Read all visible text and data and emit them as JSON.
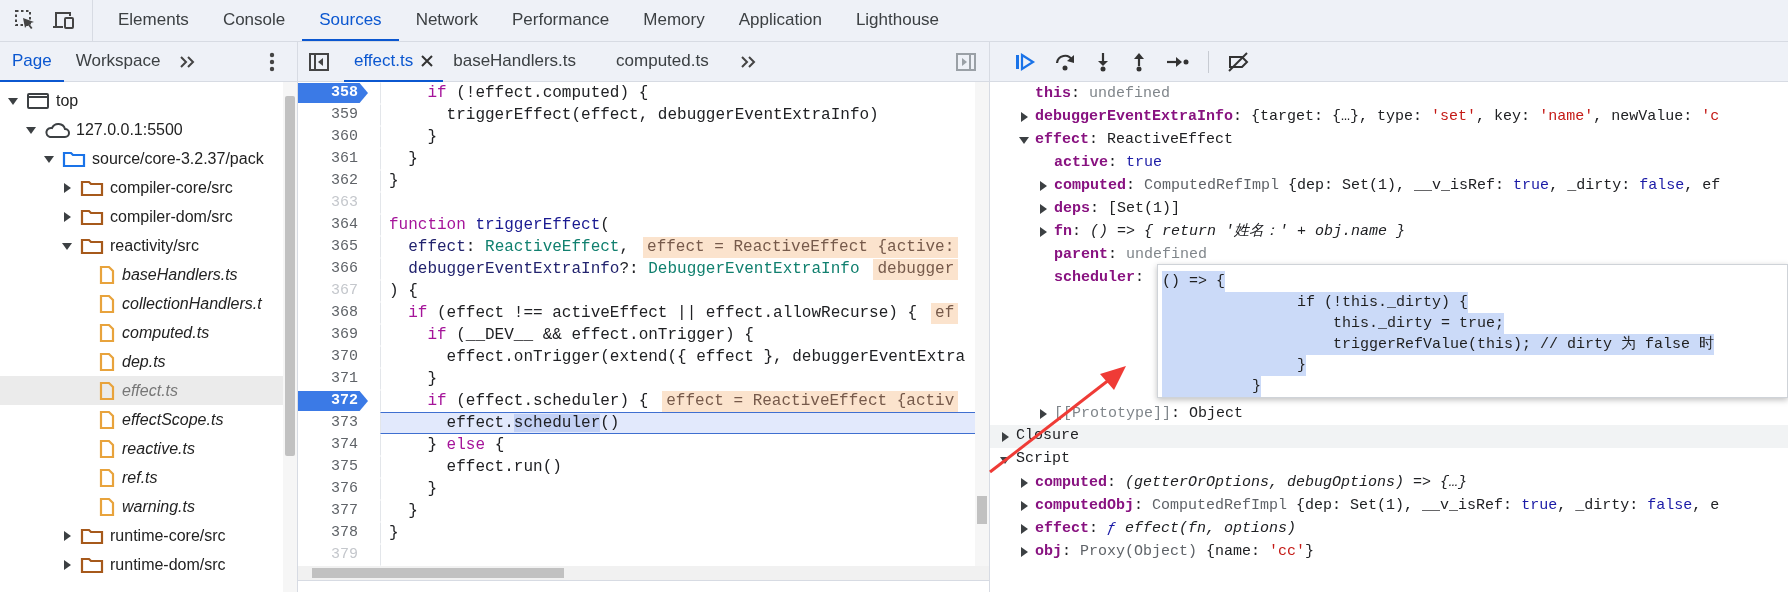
{
  "main_tabs": [
    {
      "label": "Elements",
      "selected": false
    },
    {
      "label": "Console",
      "selected": false
    },
    {
      "label": "Sources",
      "selected": true
    },
    {
      "label": "Network",
      "selected": false
    },
    {
      "label": "Performance",
      "selected": false
    },
    {
      "label": "Memory",
      "selected": false
    },
    {
      "label": "Application",
      "selected": false
    },
    {
      "label": "Lighthouse",
      "selected": false
    }
  ],
  "navigator": {
    "tabs": [
      {
        "label": "Page",
        "selected": true
      },
      {
        "label": "Workspace",
        "selected": false
      }
    ],
    "tree": [
      {
        "label": "top",
        "kind": "frame",
        "expanded": true,
        "selected": false,
        "children": [
          {
            "label": "127.0.0.1:5500",
            "kind": "origin",
            "expanded": true,
            "selected": false,
            "children": [
              {
                "label": "source/core-3.2.37/pack",
                "kind": "root-folder",
                "expanded": true,
                "selected": false,
                "children": [
                  {
                    "label": "compiler-core/src",
                    "kind": "folder",
                    "expanded": false,
                    "selected": false
                  },
                  {
                    "label": "compiler-dom/src",
                    "kind": "folder",
                    "expanded": false,
                    "selected": false
                  },
                  {
                    "label": "reactivity/src",
                    "kind": "folder",
                    "expanded": true,
                    "selected": false,
                    "children": [
                      {
                        "label": "baseHandlers.ts",
                        "kind": "file",
                        "selected": false
                      },
                      {
                        "label": "collectionHandlers.t",
                        "kind": "file",
                        "selected": false
                      },
                      {
                        "label": "computed.ts",
                        "kind": "file",
                        "selected": false
                      },
                      {
                        "label": "dep.ts",
                        "kind": "file",
                        "selected": false
                      },
                      {
                        "label": "effect.ts",
                        "kind": "file",
                        "selected": true
                      },
                      {
                        "label": "effectScope.ts",
                        "kind": "file",
                        "selected": false
                      },
                      {
                        "label": "reactive.ts",
                        "kind": "file",
                        "selected": false
                      },
                      {
                        "label": "ref.ts",
                        "kind": "file",
                        "selected": false
                      },
                      {
                        "label": "warning.ts",
                        "kind": "file",
                        "selected": false
                      }
                    ]
                  },
                  {
                    "label": "runtime-core/src",
                    "kind": "folder",
                    "expanded": false,
                    "selected": false
                  },
                  {
                    "label": "runtime-dom/src",
                    "kind": "folder",
                    "expanded": false,
                    "selected": false
                  }
                ]
              }
            ]
          }
        ]
      }
    ]
  },
  "editor": {
    "tabs": [
      {
        "label": "effect.ts",
        "selected": true,
        "closable": true
      },
      {
        "label": "baseHandlers.ts",
        "selected": false,
        "closable": false
      },
      {
        "label": "computed.ts",
        "selected": false,
        "closable": false
      }
    ],
    "lines": [
      {
        "number": "358",
        "breakpoint": true,
        "breakable": true,
        "current": false,
        "tokens": [
          {
            "text": "    if",
            "kind": "kw"
          },
          {
            "text": " (!effect.computed) {",
            "kind": "plain"
          }
        ]
      },
      {
        "number": "359",
        "breakpoint": false,
        "breakable": true,
        "current": false,
        "tokens": [
          {
            "text": "      triggerEffect(effect, debuggerEventExtraInfo)",
            "kind": "plain"
          }
        ]
      },
      {
        "number": "360",
        "breakpoint": false,
        "breakable": true,
        "current": false,
        "tokens": [
          {
            "text": "    }",
            "kind": "plain"
          }
        ]
      },
      {
        "number": "361",
        "breakpoint": false,
        "breakable": true,
        "current": false,
        "tokens": [
          {
            "text": "  }",
            "kind": "plain"
          }
        ]
      },
      {
        "number": "362",
        "breakpoint": false,
        "breakable": true,
        "current": false,
        "tokens": [
          {
            "text": "}",
            "kind": "plain"
          }
        ]
      },
      {
        "number": "363",
        "breakpoint": false,
        "breakable": false,
        "current": false
      },
      {
        "number": "364",
        "breakpoint": false,
        "breakable": true,
        "current": false,
        "tokens": [
          {
            "text": "function",
            "kind": "kw"
          },
          {
            "text": " triggerEffect",
            "kind": "def"
          },
          {
            "text": "(",
            "kind": "plain"
          }
        ]
      },
      {
        "number": "365",
        "breakpoint": false,
        "breakable": true,
        "current": false,
        "tokens": [
          {
            "text": "  effect",
            "kind": "param"
          },
          {
            "text": ":",
            "kind": "plain"
          },
          {
            "text": " ReactiveEffect",
            "kind": "type"
          },
          {
            "text": ",",
            "kind": "plain"
          }
        ],
        "hint": "effect = ReactiveEffect {active:"
      },
      {
        "number": "366",
        "breakpoint": false,
        "breakable": true,
        "current": false,
        "tokens": [
          {
            "text": "  debuggerEventExtraInfo",
            "kind": "param"
          },
          {
            "text": "?:",
            "kind": "plain"
          },
          {
            "text": " DebuggerEventExtraInfo",
            "kind": "type"
          }
        ],
        "hint": "debugger"
      },
      {
        "number": "367",
        "breakpoint": false,
        "breakable": false,
        "current": false,
        "tokens": [
          {
            "text": ") {",
            "kind": "plain"
          }
        ]
      },
      {
        "number": "368",
        "breakpoint": false,
        "breakable": true,
        "current": false,
        "tokens": [
          {
            "text": "  if",
            "kind": "kw"
          },
          {
            "text": " (effect !== activeEffect || effect.allowRecurse) {",
            "kind": "plain"
          }
        ],
        "hint": "ef"
      },
      {
        "number": "369",
        "breakpoint": false,
        "breakable": true,
        "current": false,
        "tokens": [
          {
            "text": "    if",
            "kind": "kw"
          },
          {
            "text": " (__DEV__ && effect.onTrigger) {",
            "kind": "plain"
          }
        ]
      },
      {
        "number": "370",
        "breakpoint": false,
        "breakable": true,
        "current": false,
        "tokens": [
          {
            "text": "      effect.onTrigger(extend({ effect }, debuggerEventExtra",
            "kind": "plain"
          }
        ]
      },
      {
        "number": "371",
        "breakpoint": false,
        "breakable": true,
        "current": false,
        "tokens": [
          {
            "text": "    }",
            "kind": "plain"
          }
        ]
      },
      {
        "number": "372",
        "breakpoint": true,
        "breakable": true,
        "current": false,
        "tokens": [
          {
            "text": "    if",
            "kind": "kw"
          },
          {
            "text": " (effect.scheduler) {",
            "kind": "plain"
          }
        ],
        "hint": "effect = ReactiveEffect {activ"
      },
      {
        "number": "373",
        "breakpoint": false,
        "breakable": true,
        "current": true,
        "tokens": [
          {
            "text": "      effect.",
            "kind": "plain"
          },
          {
            "text": "scheduler",
            "kind": "sel"
          },
          {
            "text": "()",
            "kind": "plain"
          }
        ]
      },
      {
        "number": "374",
        "breakpoint": false,
        "breakable": true,
        "current": false,
        "tokens": [
          {
            "text": "    }",
            "kind": "plain"
          },
          {
            "text": " else",
            "kind": "kw"
          },
          {
            "text": " {",
            "kind": "plain"
          }
        ]
      },
      {
        "number": "375",
        "breakpoint": false,
        "breakable": true,
        "current": false,
        "tokens": [
          {
            "text": "      effect.run()",
            "kind": "plain"
          }
        ]
      },
      {
        "number": "376",
        "breakpoint": false,
        "breakable": true,
        "current": false,
        "tokens": [
          {
            "text": "    }",
            "kind": "plain"
          }
        ]
      },
      {
        "number": "377",
        "breakpoint": false,
        "breakable": true,
        "current": false,
        "tokens": [
          {
            "text": "  }",
            "kind": "plain"
          }
        ]
      },
      {
        "number": "378",
        "breakpoint": false,
        "breakable": true,
        "current": false,
        "tokens": [
          {
            "text": "}",
            "kind": "plain"
          }
        ]
      },
      {
        "number": "379",
        "breakpoint": false,
        "breakable": false,
        "current": false
      }
    ]
  },
  "local_rows": [
    {
      "tokens": [
        {
          "text": "this",
          "kind": "name"
        },
        {
          "text": ": ",
          "kind": "plain"
        },
        {
          "text": "undefined",
          "kind": "dim"
        }
      ]
    },
    {
      "expanded": false,
      "tokens": [
        {
          "text": "debuggerEventExtraInfo",
          "kind": "name"
        },
        {
          "text": ": {target: {…}, type: ",
          "kind": "plain"
        },
        {
          "text": "'set'",
          "kind": "str"
        },
        {
          "text": ", key: ",
          "kind": "plain"
        },
        {
          "text": "'name'",
          "kind": "str"
        },
        {
          "text": ", newValue: ",
          "kind": "plain"
        },
        {
          "text": "'c",
          "kind": "str"
        }
      ]
    },
    {
      "expanded": true,
      "tokens": [
        {
          "text": "effect",
          "kind": "name"
        },
        {
          "text": ": ReactiveEffect",
          "kind": "plain"
        }
      ],
      "children": [
        {
          "tokens": [
            {
              "text": "active",
              "kind": "name"
            },
            {
              "text": ": ",
              "kind": "plain"
            },
            {
              "text": "true",
              "kind": "lit"
            }
          ]
        },
        {
          "expanded": false,
          "tokens": [
            {
              "text": "computed",
              "kind": "name"
            },
            {
              "text": ": ",
              "kind": "plain"
            },
            {
              "text": "ComputedRefImpl",
              "kind": "cls"
            },
            {
              "text": " {dep: Set(1), __v_isRef: ",
              "kind": "plain"
            },
            {
              "text": "true",
              "kind": "lit"
            },
            {
              "text": ", _dirty: ",
              "kind": "plain"
            },
            {
              "text": "false",
              "kind": "lit"
            },
            {
              "text": ", ef",
              "kind": "plain"
            }
          ]
        },
        {
          "expanded": false,
          "tokens": [
            {
              "text": "deps",
              "kind": "name"
            },
            {
              "text": ": [Set(1)]",
              "kind": "plain"
            }
          ]
        },
        {
          "expanded": false,
          "tokens": [
            {
              "text": "fn",
              "kind": "name"
            },
            {
              "text": ": ",
              "kind": "plain"
            },
            {
              "text": "() => { return '姓名：' + obj.name }",
              "kind": "italic"
            }
          ]
        },
        {
          "tokens": [
            {
              "text": "parent",
              "kind": "name"
            },
            {
              "text": ": ",
              "kind": "plain"
            },
            {
              "text": "undefined",
              "kind": "dim"
            }
          ]
        },
        {
          "tokens": [
            {
              "text": "scheduler",
              "kind": "name"
            },
            {
              "text": ": ",
              "kind": "plain"
            }
          ],
          "popover": [
            "() => {",
            "               if (!this._dirty) {",
            "                   this._dirty = true;",
            "                   triggerRefValue(this); // dirty 为 false 时",
            "               }",
            "          }"
          ]
        },
        {
          "expanded": false,
          "tokens": [
            {
              "text": "[[Prototype]]",
              "kind": "dim"
            },
            {
              "text": ": Object",
              "kind": "plain"
            }
          ]
        }
      ]
    }
  ],
  "sections": [
    {
      "label": "Closure",
      "expanded": false,
      "highlighted": true
    },
    {
      "label": "Script",
      "expanded": true,
      "highlighted": false,
      "children": [
        {
          "expanded": false,
          "tokens": [
            {
              "text": "computed",
              "kind": "name"
            },
            {
              "text": ": ",
              "kind": "plain"
            },
            {
              "text": "(getterOrOptions, debugOptions) => {…}",
              "kind": "italic"
            }
          ]
        },
        {
          "expanded": false,
          "tokens": [
            {
              "text": "computedObj",
              "kind": "name"
            },
            {
              "text": ": ",
              "kind": "plain"
            },
            {
              "text": "ComputedRefImpl",
              "kind": "cls"
            },
            {
              "text": " {dep: Set(1), __v_isRef: ",
              "kind": "plain"
            },
            {
              "text": "true",
              "kind": "lit"
            },
            {
              "text": ", _dirty: ",
              "kind": "plain"
            },
            {
              "text": "false",
              "kind": "lit"
            },
            {
              "text": ", e",
              "kind": "plain"
            }
          ]
        },
        {
          "expanded": false,
          "tokens": [
            {
              "text": "effect",
              "kind": "name"
            },
            {
              "text": ": ",
              "kind": "plain"
            },
            {
              "text": "ƒ",
              "kind": "fsym"
            },
            {
              "text": " effect(fn, options)",
              "kind": "italic"
            }
          ]
        },
        {
          "expanded": false,
          "tokens": [
            {
              "text": "obj",
              "kind": "name"
            },
            {
              "text": ": ",
              "kind": "plain"
            },
            {
              "text": "Proxy(Object)",
              "kind": "cls"
            },
            {
              "text": " {name: ",
              "kind": "plain"
            },
            {
              "text": "'cc'",
              "kind": "str"
            },
            {
              "text": "}",
              "kind": "plain"
            }
          ]
        }
      ]
    }
  ]
}
